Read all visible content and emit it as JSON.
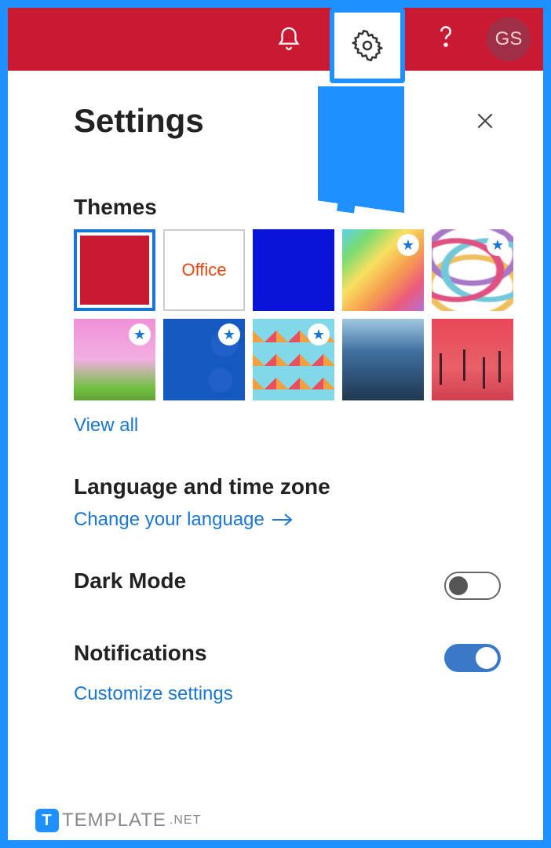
{
  "topbar": {
    "avatar_initials": "GS"
  },
  "panel": {
    "title": "Settings"
  },
  "themes": {
    "section_title": "Themes",
    "office_label": "Office",
    "view_all": "View all",
    "tiles": [
      {
        "id": "red",
        "selected": true,
        "starred": false
      },
      {
        "id": "office",
        "selected": false,
        "starred": false
      },
      {
        "id": "blue",
        "selected": false,
        "starred": false
      },
      {
        "id": "rainbow",
        "selected": false,
        "starred": true
      },
      {
        "id": "ribbon",
        "selected": false,
        "starred": true
      },
      {
        "id": "unicorn",
        "selected": false,
        "starred": true
      },
      {
        "id": "basketball",
        "selected": false,
        "starred": true
      },
      {
        "id": "blocks",
        "selected": false,
        "starred": true
      },
      {
        "id": "ocean",
        "selected": false,
        "starred": false
      },
      {
        "id": "sunset",
        "selected": false,
        "starred": false
      }
    ]
  },
  "language": {
    "section_title": "Language and time zone",
    "link_label": "Change your language"
  },
  "dark_mode": {
    "section_title": "Dark Mode",
    "enabled": false
  },
  "notifications": {
    "section_title": "Notifications",
    "enabled": true,
    "link_label": "Customize settings"
  },
  "watermark": {
    "brand": "TEMPLATE",
    "suffix": ".NET"
  }
}
